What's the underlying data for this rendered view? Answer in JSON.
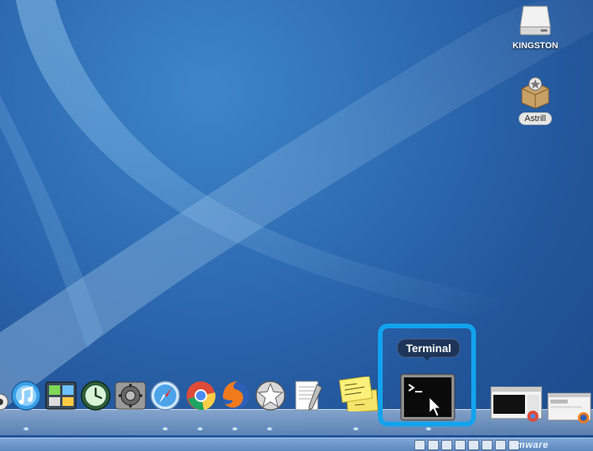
{
  "desktop": {
    "icons": [
      {
        "label": "KINGSTON",
        "icon": "external-drive-icon"
      },
      {
        "label": "Astrill",
        "icon": "package-icon"
      }
    ]
  },
  "dock": {
    "items": [
      {
        "name": "finder-partial",
        "icon": "finder-icon"
      },
      {
        "name": "itunes",
        "icon": "itunes-icon"
      },
      {
        "name": "dashboard",
        "icon": "dashboard-icon"
      },
      {
        "name": "time-machine",
        "icon": "time-machine-icon"
      },
      {
        "name": "system-preferences",
        "icon": "system-preferences-icon"
      },
      {
        "name": "safari",
        "icon": "safari-icon"
      },
      {
        "name": "chrome",
        "icon": "chrome-icon"
      },
      {
        "name": "firefox",
        "icon": "firefox-icon"
      },
      {
        "name": "astrill",
        "icon": "astrill-star-icon"
      },
      {
        "name": "textedit",
        "icon": "textedit-icon"
      },
      {
        "name": "stickies",
        "icon": "stickies-icon"
      },
      {
        "name": "terminal",
        "icon": "terminal-icon"
      },
      {
        "name": "window-thumbnail-1",
        "icon": "window-thumbnail-icon"
      },
      {
        "name": "window-thumbnail-2",
        "icon": "window-thumbnail-icon"
      }
    ],
    "tooltip": "Terminal",
    "highlighted": "terminal"
  },
  "taskbar": {
    "brand": "vmware"
  },
  "colors": {
    "highlight": "#12a3ee",
    "tooltip_bg": "#1c3050"
  }
}
